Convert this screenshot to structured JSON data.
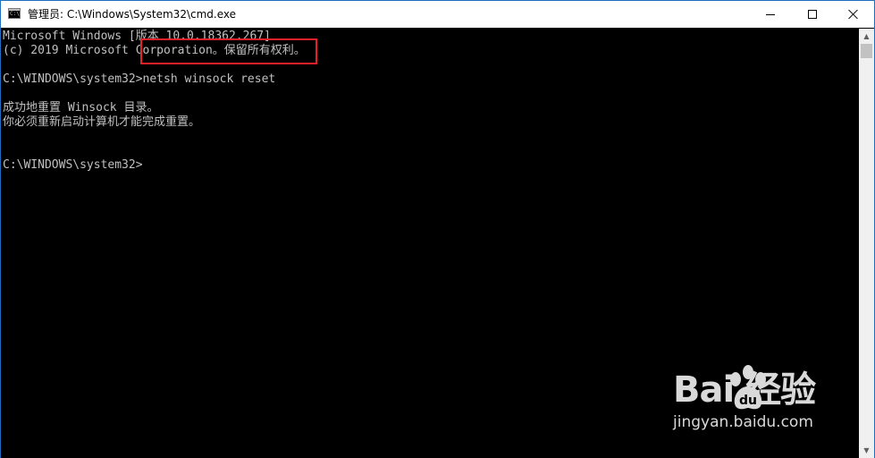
{
  "window": {
    "title": "管理员: C:\\Windows\\System32\\cmd.exe",
    "icon": "cmd-icon"
  },
  "controls": {
    "minimize": "minimize-icon",
    "maximize": "maximize-icon",
    "close": "close-icon"
  },
  "console": {
    "lines": [
      "Microsoft Windows [版本 10.0.18362.267]",
      "(c) 2019 Microsoft Corporation。保留所有权利。",
      "C:\\WINDOWS\\system32>netsh winsock reset",
      "成功地重置 Winsock 目录。",
      "你必须重新启动计算机才能完成重置。",
      "C:\\WINDOWS\\system32>"
    ],
    "text_color": "#c0c0c0",
    "background": "#000000"
  },
  "highlight": {
    "color": "#e8202a"
  },
  "watermark": {
    "logo": "Bai  经验",
    "url": "jingyan.baidu.com"
  }
}
